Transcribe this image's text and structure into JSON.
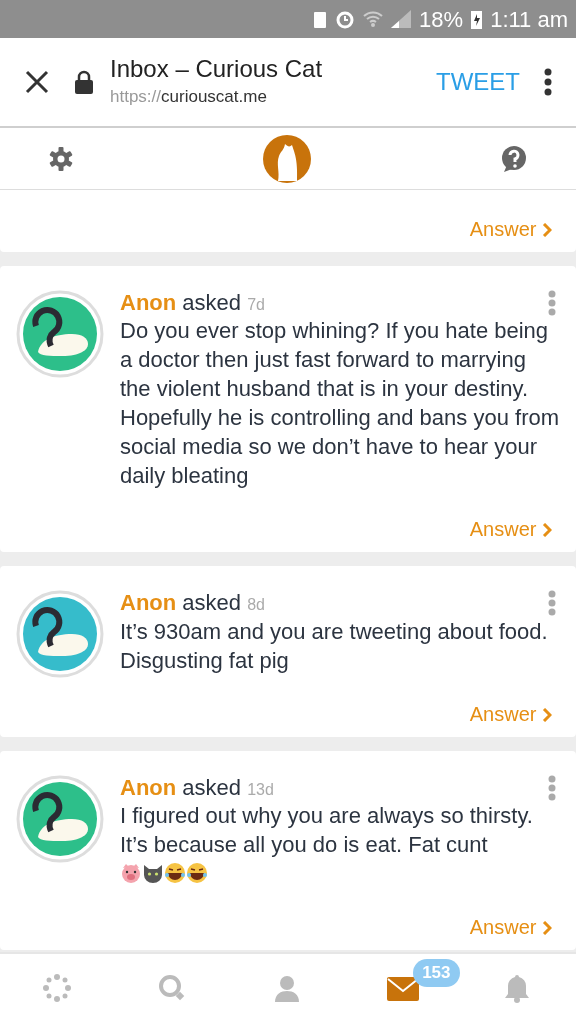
{
  "status_bar": {
    "battery": "18%",
    "time": "1:11 am"
  },
  "browser_bar": {
    "title": "Inbox – Curious Cat",
    "url_scheme": "https://",
    "url_host": "curiouscat.me",
    "action": "TWEET"
  },
  "first_card": {
    "answer": "Answer"
  },
  "questions": [
    {
      "name": "Anon",
      "verb": "asked",
      "age": "7d",
      "color": "#2dbf8a",
      "text": "Do you ever stop whining? If you hate being a doctor then just fast forward to marrying the violent husband that is in your destiny. Hopefully he is controlling and bans you from social media so we don’t have to hear your daily bleating",
      "answer": "Answer"
    },
    {
      "name": "Anon",
      "verb": "asked",
      "age": "8d",
      "color": "#36bccb",
      "text": "It’s 930am and you are tweeting about food. Disgusting fat pig",
      "answer": "Answer"
    },
    {
      "name": "Anon",
      "verb": "asked",
      "age": "13d",
      "color": "#2dbf8a",
      "text": "I figured out why you are always so thirsty. It’s because all you do is eat. Fat cunt",
      "emojis": [
        {
          "kind": "pig"
        },
        {
          "kind": "cat"
        },
        {
          "kind": "laugh"
        },
        {
          "kind": "laugh"
        }
      ],
      "answer": "Answer"
    }
  ],
  "bottom_nav": [
    {
      "kind": "discover",
      "selected": false
    },
    {
      "kind": "search",
      "selected": false
    },
    {
      "kind": "profile",
      "selected": false
    },
    {
      "kind": "inbox",
      "selected": true,
      "badge": "153"
    },
    {
      "kind": "notifications",
      "selected": false
    }
  ]
}
